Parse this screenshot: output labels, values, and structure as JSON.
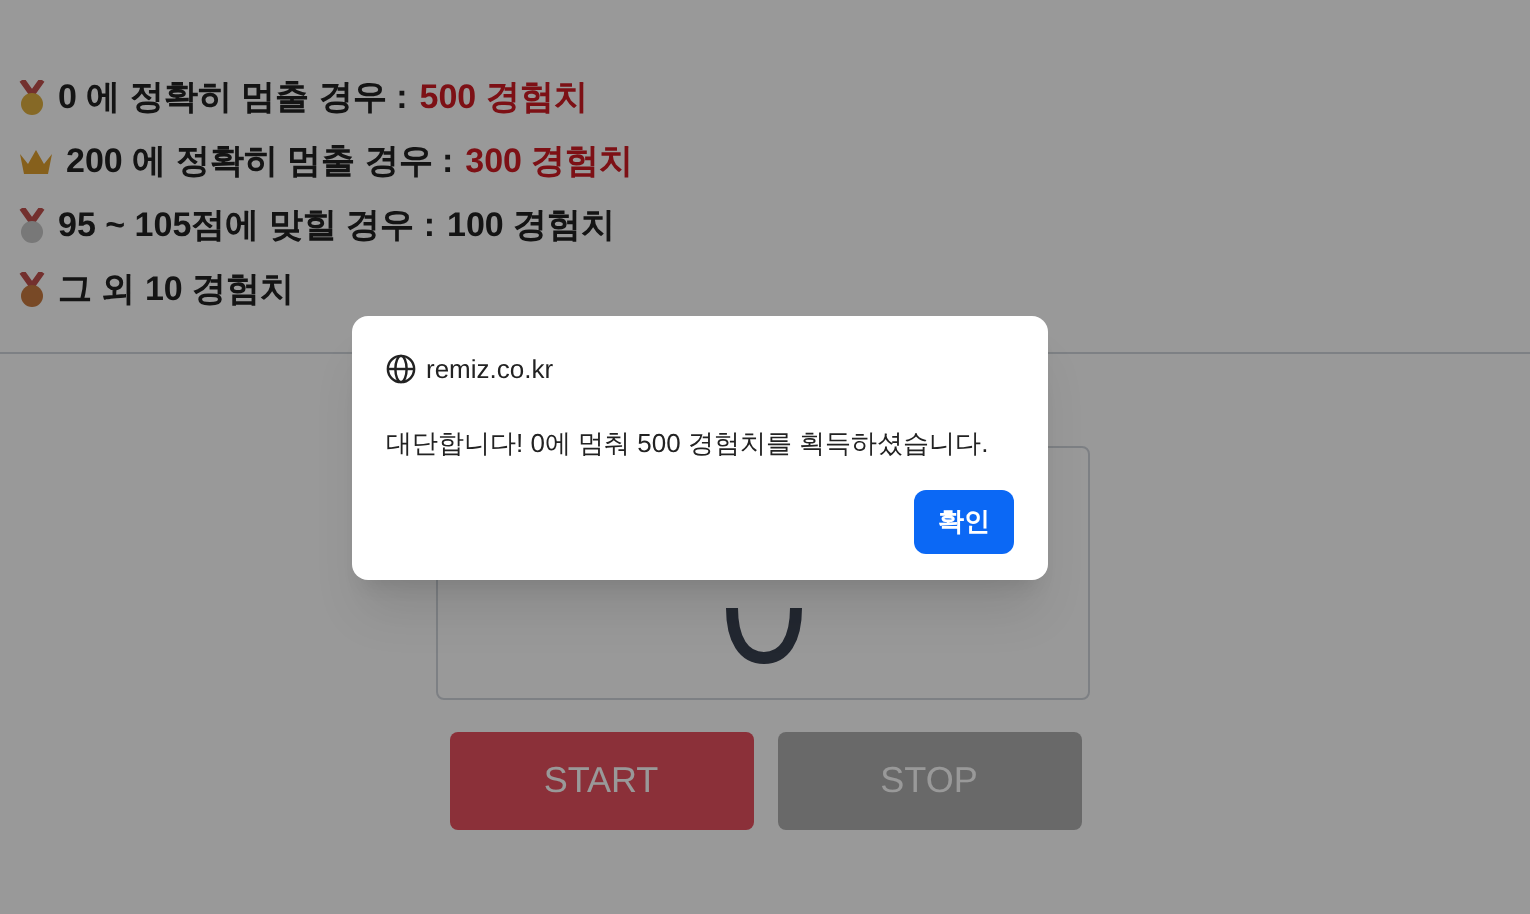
{
  "rules": [
    {
      "kind": "gold",
      "label": "0 에 정확히 멈출 경우 :",
      "reward": "500 경험치",
      "highlight": true
    },
    {
      "kind": "crown",
      "label": "200 에 정확히 멈출 경우 :",
      "reward": "300 경험치",
      "highlight": true
    },
    {
      "kind": "silver",
      "label": "95 ~ 105점에 맞힐 경우 :",
      "reward": "100 경험치",
      "highlight": false
    },
    {
      "kind": "bronze",
      "label": "그 외 10 경험치"
    }
  ],
  "buttons": [
    {
      "label": "START",
      "disabled": false
    },
    {
      "label": "STOP",
      "disabled": true
    }
  ],
  "dialog": {
    "site": "remiz.co.kr",
    "message": "대단합니다! 0에 멈춰 500 경험치를 획득하셨습니다.",
    "button": "확인"
  }
}
